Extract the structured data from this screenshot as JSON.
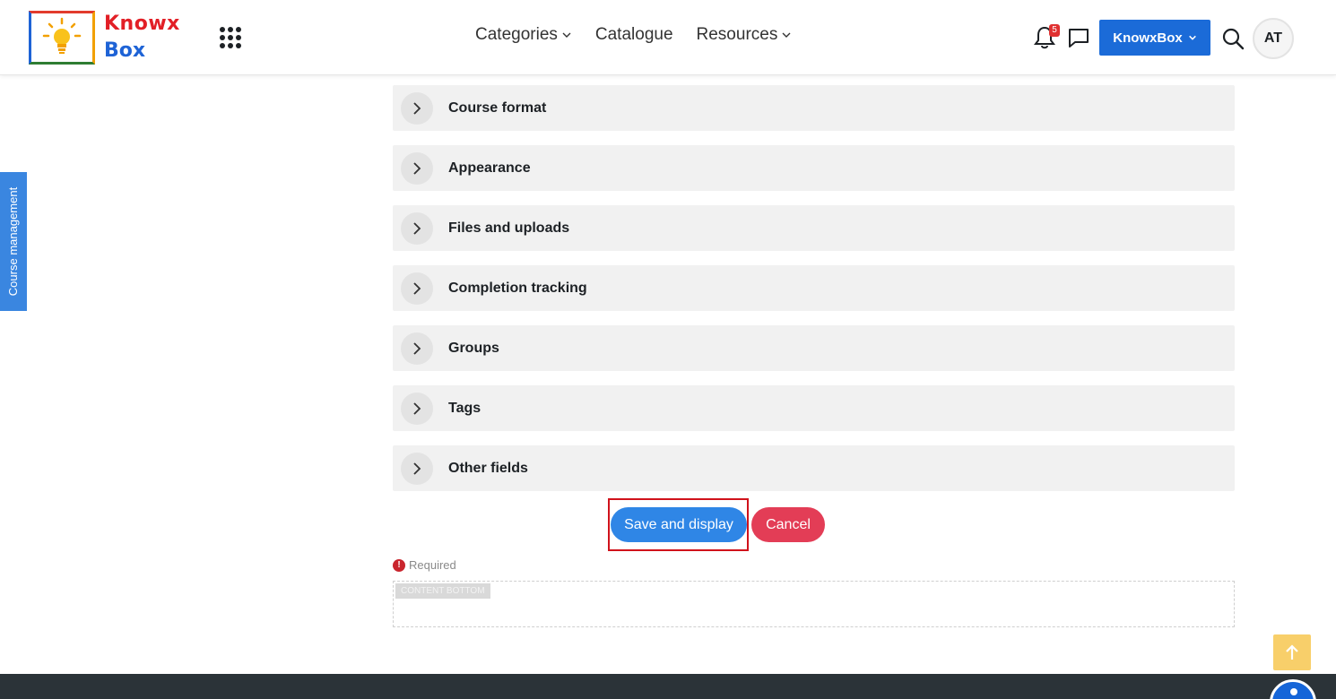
{
  "brand": {
    "logo_word1": "Knowx",
    "logo_word2": "Box",
    "colors": {
      "red": "#e21f26",
      "blue": "#1e63d6",
      "yellow": "#f2a000",
      "green": "#2e7d32"
    }
  },
  "nav": {
    "items": [
      {
        "label": "Categories",
        "has_dropdown": true
      },
      {
        "label": "Catalogue",
        "has_dropdown": false
      },
      {
        "label": "Resources",
        "has_dropdown": true
      }
    ]
  },
  "header": {
    "notification_count": "5",
    "site_menu_label": "KnowxBox",
    "avatar_initials": "AT"
  },
  "side_tab": {
    "label": "Course management"
  },
  "sections": [
    {
      "label": "Course format"
    },
    {
      "label": "Appearance"
    },
    {
      "label": "Files and uploads"
    },
    {
      "label": "Completion tracking"
    },
    {
      "label": "Groups"
    },
    {
      "label": "Tags"
    },
    {
      "label": "Other fields"
    }
  ],
  "actions": {
    "save_label": "Save and display",
    "cancel_label": "Cancel"
  },
  "form": {
    "required_label": "Required",
    "content_bottom_label": "CONTENT BOTTOM"
  },
  "colors": {
    "primary": "#2f86e6",
    "danger": "#e33d56",
    "section_bg": "#f1f1f1",
    "footer": "#2b3338"
  }
}
